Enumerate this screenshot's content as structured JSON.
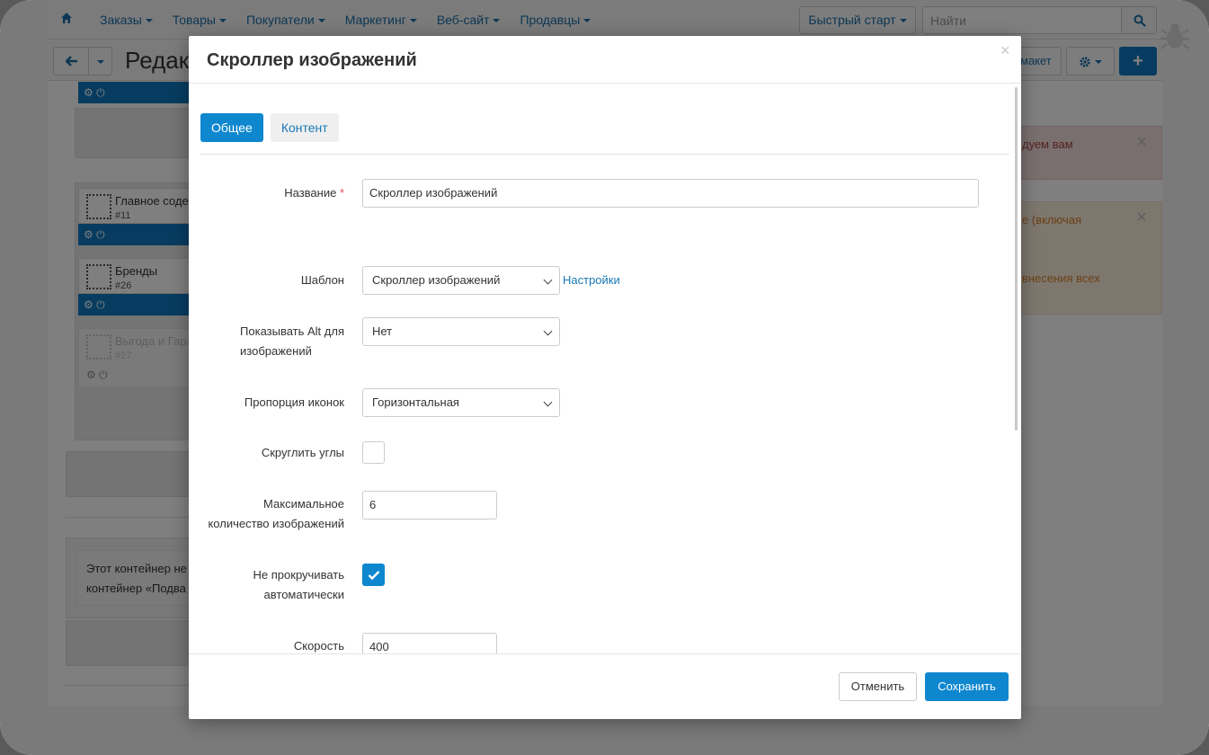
{
  "colors": {
    "primary": "#0e87cf",
    "link": "#1b78b5",
    "required": "#d9534f",
    "alert_danger": "#a94442",
    "alert_warning": "#d9822b"
  },
  "navbar": {
    "home_icon": "home-icon",
    "menu": [
      "Заказы",
      "Товары",
      "Покупатели",
      "Маркетинг",
      "Веб-сайт",
      "Продавцы"
    ],
    "quick_start": "Быстрый старт",
    "search_placeholder": "Найти",
    "search_icon": "search-icon"
  },
  "subbar": {
    "page_title": "Редакт",
    "layout_button": "макет",
    "gear_icon": "gear-icon",
    "plus_label": "+"
  },
  "background": {
    "widgets": [
      {
        "title": "Главное содер",
        "id": "#11"
      },
      {
        "title": "Бренды",
        "id": "#26"
      },
      {
        "title": "Выгода и Гара",
        "id": "#27"
      }
    ],
    "alert_danger_text": "дуем вам",
    "alert_warning_line1": "е (включая",
    "alert_warning_line2": "внесения всех",
    "info_text_line1": "Этот контейнер не",
    "info_text_line2": "контейнер «Подва"
  },
  "modal": {
    "title": "Скроллер изображений",
    "close_label": "×",
    "tabs": [
      {
        "label": "Общее",
        "active": true
      },
      {
        "label": "Контент",
        "active": false
      }
    ],
    "fields": {
      "name": {
        "label": "Название",
        "required_mark": "*",
        "value": "Скроллер изображений"
      },
      "template": {
        "label": "Шаблон",
        "value": "Скроллер изображений",
        "settings_link": "Настройки"
      },
      "show_alt": {
        "label_line1": "Показывать Alt для",
        "label_line2": "изображений",
        "value": "Нет"
      },
      "icon_ratio": {
        "label": "Пропорция иконок",
        "value": "Горизонтальная"
      },
      "round_corners": {
        "label": "Скруглить углы",
        "checked": false
      },
      "max_images": {
        "label_line1": "Максимальное",
        "label_line2": "количество изображений",
        "value": "6"
      },
      "no_autoscroll": {
        "label_line1": "Не прокручивать",
        "label_line2": "автоматически",
        "checked": true
      },
      "speed": {
        "label": "Скорость",
        "value": "400"
      }
    },
    "footer": {
      "cancel": "Отменить",
      "save": "Сохранить"
    }
  }
}
